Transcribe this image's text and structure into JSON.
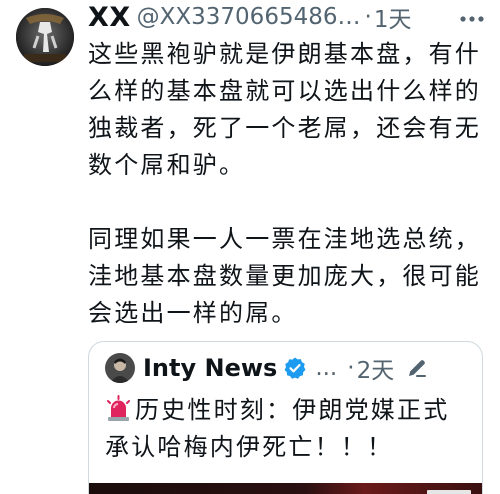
{
  "tweet": {
    "display_name": "XX",
    "handle": "@XX3370665486…",
    "separator": "·",
    "time": "1天",
    "body": "这些黑袍驴就是伊朗基本盘，有什么样的基本盘就可以选出什么样的独裁者，死了一个老屌，还会有无数个屌和驴。\n\n同理如果一人一票在洼地选总统，洼地基本盘数量更加庞大，很可能会选出一样的屌。",
    "avatar_icon": "horse-avatar-icon",
    "more_icon": "more-dots-icon"
  },
  "quote": {
    "name": "Inty News",
    "handle": "...",
    "separator": "·",
    "time": "2天",
    "text": "历史性时刻：伊朗党媒正式承认哈梅内伊死亡！！！",
    "emoji_icon": "siren-icon",
    "verified_icon": "verified-badge-icon",
    "edit_icon": "edit-pencil-icon",
    "colors": {
      "verified": "#1d9bf0",
      "siren": "#e0245e"
    }
  }
}
